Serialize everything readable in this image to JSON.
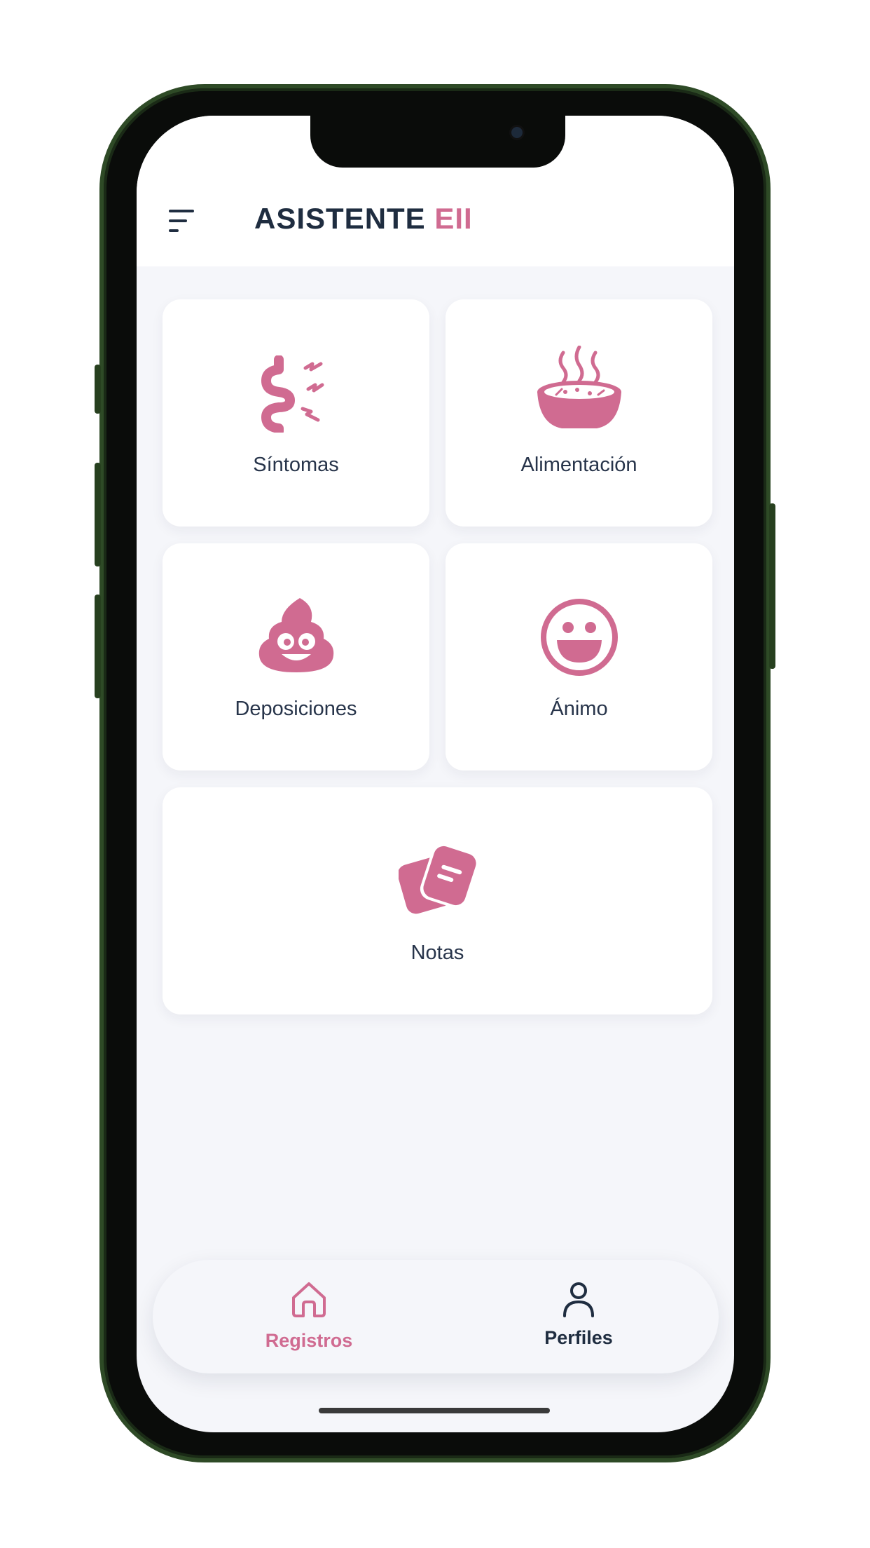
{
  "header": {
    "title_main": "ASISTENTE",
    "title_accent": "EII"
  },
  "cards": [
    {
      "id": "sintomas",
      "label": "Síntomas",
      "icon": "intestine-icon"
    },
    {
      "id": "alimentacion",
      "label": "Alimentación",
      "icon": "soup-pot-icon"
    },
    {
      "id": "deposiciones",
      "label": "Deposiciones",
      "icon": "poop-icon"
    },
    {
      "id": "animo",
      "label": "Ánimo",
      "icon": "smiley-icon"
    },
    {
      "id": "notas",
      "label": "Notas",
      "icon": "notes-icon"
    }
  ],
  "bottom_nav": {
    "items": [
      {
        "label": "Registros",
        "icon": "home-icon",
        "active": true
      },
      {
        "label": "Perfiles",
        "icon": "user-icon",
        "active": false
      }
    ]
  },
  "colors": {
    "accent": "#d06b91",
    "text_dark": "#1f2d40",
    "screen_bg": "#f5f6fa"
  }
}
